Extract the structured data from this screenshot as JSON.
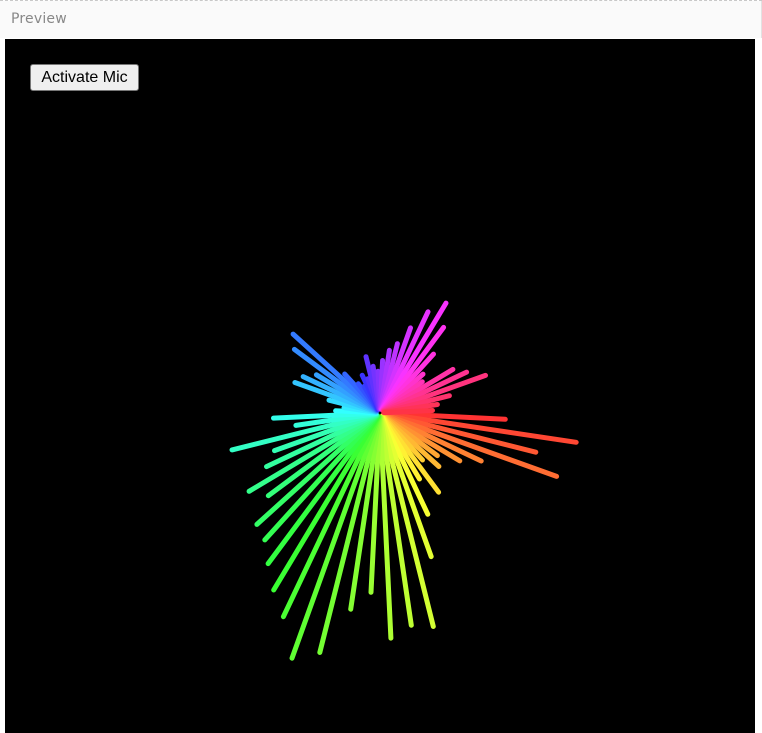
{
  "preview": {
    "label": "Preview"
  },
  "mic_button": {
    "label": "Activate Mic"
  },
  "visualizer": {
    "background_color": "#000000",
    "ray_count": 64,
    "ray_levels": [
      0.45,
      0.72,
      0.58,
      0.68,
      0.4,
      0.33,
      0.25,
      0.28,
      0.22,
      0.35,
      0.27,
      0.4,
      0.55,
      0.8,
      0.78,
      0.82,
      0.65,
      0.72,
      0.9,
      0.95,
      0.82,
      0.75,
      0.68,
      0.62,
      0.6,
      0.5,
      0.55,
      0.45,
      0.4,
      0.55,
      0.3,
      0.38,
      0.15,
      0.12,
      0.18,
      0.32,
      0.3,
      0.26,
      0.38,
      0.42,
      0.18,
      0.12,
      0.1,
      0.14,
      0.12,
      0.2,
      0.16,
      0.14,
      0.18,
      0.22,
      0.25,
      0.32,
      0.4,
      0.46,
      0.38,
      0.28,
      0.2,
      0.18,
      0.3,
      0.34,
      0.4,
      0.25,
      0.2,
      0.18
    ],
    "color_scheme": "rainbow"
  }
}
